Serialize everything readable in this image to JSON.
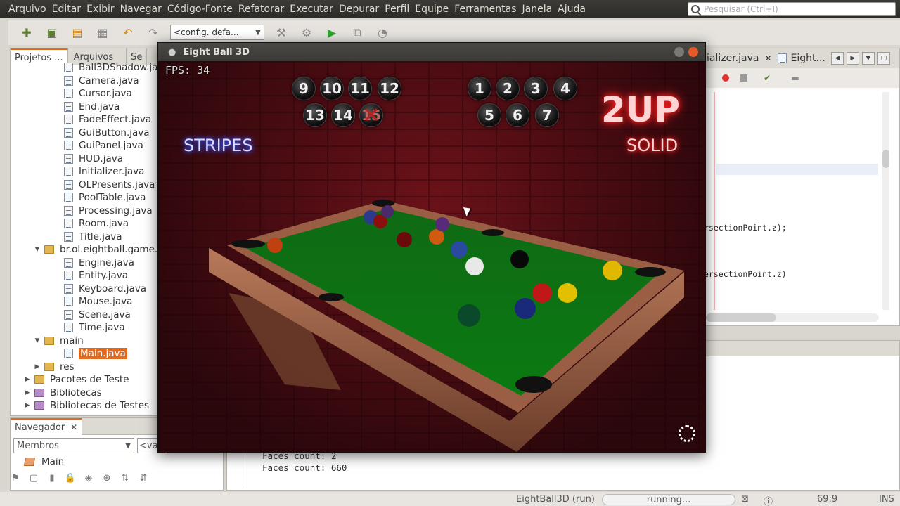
{
  "menu": [
    "Arquivo",
    "Editar",
    "Exibir",
    "Navegar",
    "Código-Fonte",
    "Refatorar",
    "Executar",
    "Depurar",
    "Perfil",
    "Equipe",
    "Ferramentas",
    "Janela",
    "Ajuda"
  ],
  "search": {
    "placeholder": "Pesquisar (Ctrl+I)"
  },
  "toolbar": {
    "config": "<config. defa..."
  },
  "left_tabs": [
    "Projetos ...",
    "Arquivos",
    "Se"
  ],
  "tree": [
    {
      "label": "Ball3DShadow.java",
      "kind": "file",
      "indent": 2
    },
    {
      "label": "Camera.java",
      "kind": "file",
      "indent": 2
    },
    {
      "label": "Cursor.java",
      "kind": "file",
      "indent": 2
    },
    {
      "label": "End.java",
      "kind": "file",
      "indent": 2
    },
    {
      "label": "FadeEffect.java",
      "kind": "file",
      "indent": 2
    },
    {
      "label": "GuiButton.java",
      "kind": "file",
      "indent": 2
    },
    {
      "label": "GuiPanel.java",
      "kind": "file",
      "indent": 2
    },
    {
      "label": "HUD.java",
      "kind": "file",
      "indent": 2
    },
    {
      "label": "Initializer.java",
      "kind": "file",
      "indent": 2
    },
    {
      "label": "OLPresents.java",
      "kind": "file",
      "indent": 2
    },
    {
      "label": "PoolTable.java",
      "kind": "file",
      "indent": 2
    },
    {
      "label": "Processing.java",
      "kind": "file",
      "indent": 2
    },
    {
      "label": "Room.java",
      "kind": "file",
      "indent": 2
    },
    {
      "label": "Title.java",
      "kind": "file",
      "indent": 2
    },
    {
      "label": "br.ol.eightball.game.",
      "kind": "pkg",
      "indent": 1,
      "tri": "▼"
    },
    {
      "label": "Engine.java",
      "kind": "file",
      "indent": 2
    },
    {
      "label": "Entity.java",
      "kind": "file",
      "indent": 2
    },
    {
      "label": "Keyboard.java",
      "kind": "file",
      "indent": 2
    },
    {
      "label": "Mouse.java",
      "kind": "file",
      "indent": 2
    },
    {
      "label": "Scene.java",
      "kind": "file",
      "indent": 2
    },
    {
      "label": "Time.java",
      "kind": "file",
      "indent": 2
    },
    {
      "label": "main",
      "kind": "pkg",
      "indent": 1,
      "tri": "▼"
    },
    {
      "label": "Main.java",
      "kind": "file",
      "indent": 2,
      "selected": true
    },
    {
      "label": "res",
      "kind": "pkg",
      "indent": 1,
      "tri": "▶"
    },
    {
      "label": "Pacotes de Teste",
      "kind": "pkg",
      "indent": 0,
      "tri": "▶"
    },
    {
      "label": "Bibliotecas",
      "kind": "lib",
      "indent": 0,
      "tri": "▶"
    },
    {
      "label": "Bibliotecas de Testes",
      "kind": "lib",
      "indent": 0,
      "tri": "▶"
    }
  ],
  "navigator": {
    "tab": "Navegador",
    "members": "Membros",
    "empty": "<vaz",
    "item": "Main"
  },
  "editor": {
    "tabs": [
      {
        "label": "ializer.java"
      },
      {
        "label": "Eight..."
      }
    ],
    "code": [
      {
        "text": "rsectionPoint.z);"
      },
      {
        "text": "ersectionPoint.z)"
      }
    ]
  },
  "output": {
    "lines": [
      "Faces count: 2",
      "Faces count: 660"
    ]
  },
  "status": {
    "app": "EightBall3D (run)",
    "state": "running...",
    "pos": "69:9",
    "mode": "INS"
  },
  "game": {
    "title": "Eight Ball 3D",
    "fps": "FPS: 34",
    "stripes_label": "STRIPES",
    "player": "2UP",
    "solid_label": "SOLID",
    "stripe_balls": [
      "9",
      "10",
      "11",
      "12",
      "13",
      "14",
      "15"
    ],
    "stripe_pocketed": [
      "15"
    ],
    "solid_balls": [
      "1",
      "2",
      "3",
      "4",
      "5",
      "6",
      "7"
    ]
  }
}
